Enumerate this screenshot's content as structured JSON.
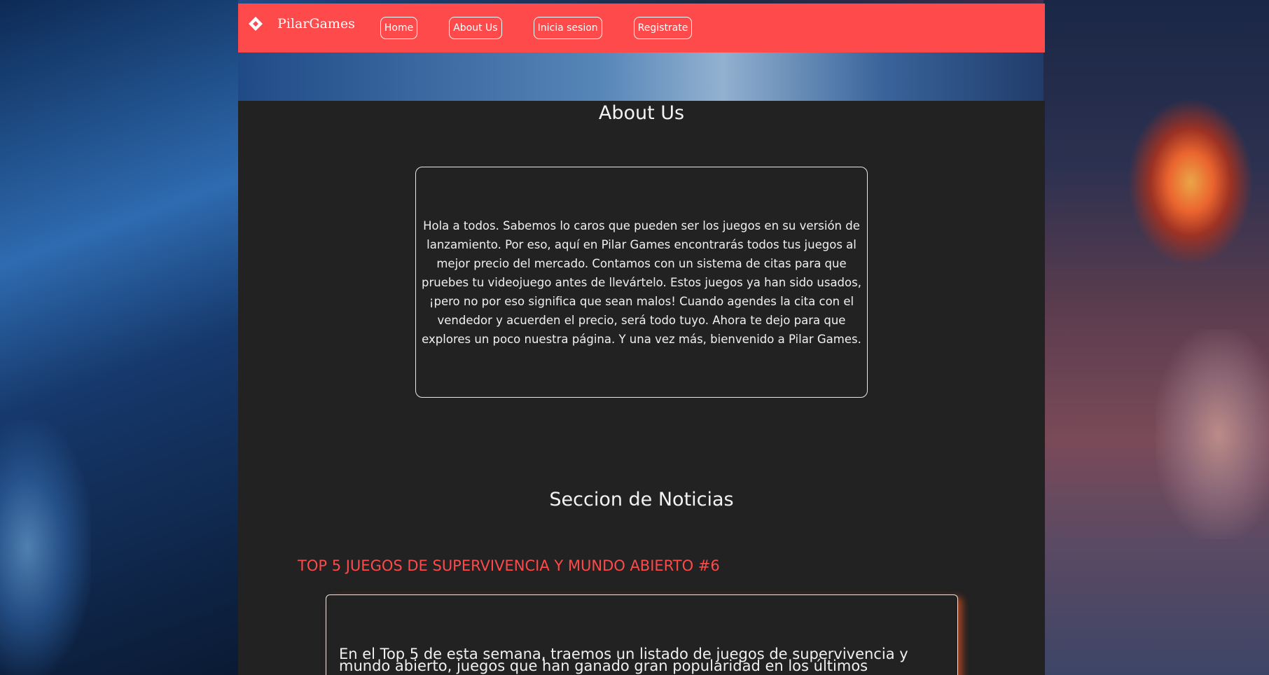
{
  "brand": {
    "name": "PilarGames",
    "icon": "diamond-logo-icon"
  },
  "nav": {
    "items": [
      {
        "label": "Home"
      },
      {
        "label": "About Us"
      },
      {
        "label": "Inicia sesion"
      },
      {
        "label": "Registrate"
      }
    ]
  },
  "about": {
    "title": "About Us",
    "text": "Hola a todos. Sabemos lo caros que pueden ser los juegos en su versión de lanzamiento. Por eso, aquí en Pilar Games encontrarás todos tus juegos al mejor precio del mercado. Contamos con un sistema de citas para que pruebes tu videojuego antes de llevártelo. Estos juegos ya han sido usados, ¡pero no por eso significa que sean malos! Cuando agendes la cita con el vendedor y acuerden el precio, será todo tuyo. Ahora te dejo para que explores un poco nuestra página. Y una vez más, bienvenido a Pilar Games."
  },
  "news": {
    "title": "Seccion de Noticias",
    "article": {
      "title": "TOP 5 JUEGOS DE SUPERVIVENCIA Y MUNDO ABIERTO #6",
      "text": "En el Top 5 de esta semana, traemos un listado de juegos de supervivencia y mundo abierto, juegos que han ganado gran popularidad en los últimos"
    }
  },
  "colors": {
    "navbar": "#fe4a4a",
    "panel": "#222222",
    "accent_text": "#fe4a4a"
  }
}
